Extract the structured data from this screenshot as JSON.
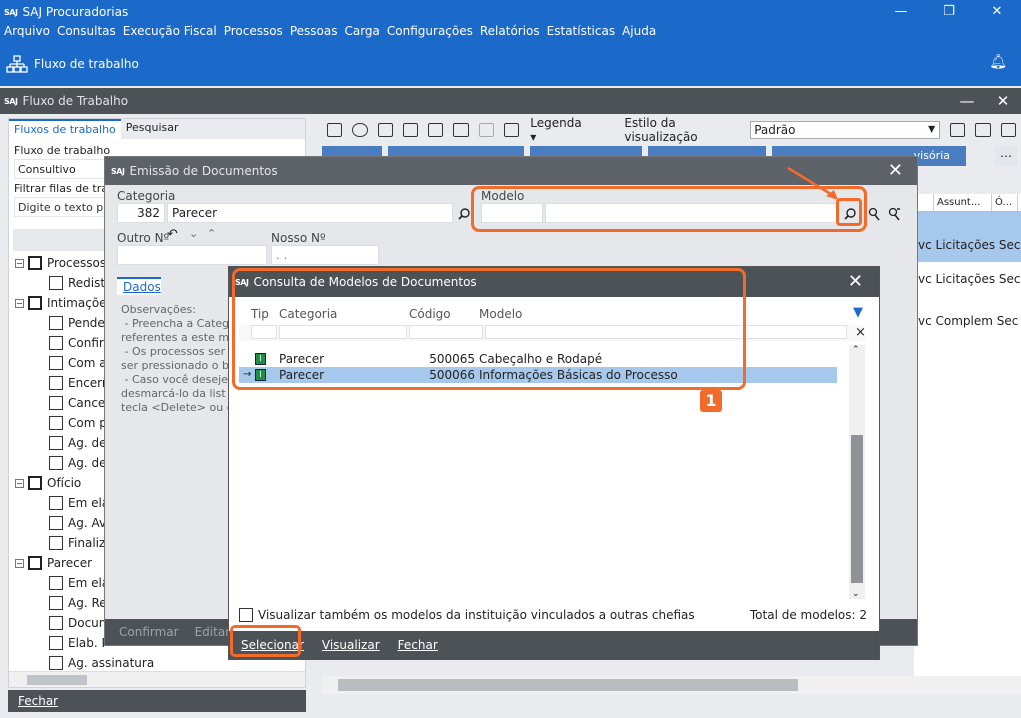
{
  "app": {
    "logo": "SAJ",
    "title": "SAJ Procuradorias",
    "menu": [
      "Arquivo",
      "Consultas",
      "Execução Fiscal",
      "Processos",
      "Pessoas",
      "Carga",
      "Configurações",
      "Relatórios",
      "Estatísticas",
      "Ajuda"
    ],
    "workflow_label": "Fluxo de trabalho"
  },
  "fluxo": {
    "title": "Fluxo de Trabalho",
    "tabs": [
      "Fluxos de trabalho",
      "Pesquisar"
    ],
    "fluxo_label": "Fluxo de trabalho",
    "fluxo_value": "Consultivo",
    "filtrar_label": "Filtrar filas de trab",
    "filtrar_placeholder": "Digite o texto pa",
    "tree": [
      {
        "level": 0,
        "label": "Processos",
        "box": "−"
      },
      {
        "level": 1,
        "label": "Redistr"
      },
      {
        "level": 0,
        "label": "Intimações",
        "box": "−"
      },
      {
        "level": 1,
        "label": "Penden"
      },
      {
        "level": 1,
        "label": "Confirm"
      },
      {
        "level": 1,
        "label": "Com as"
      },
      {
        "level": 1,
        "label": "Encerra"
      },
      {
        "level": 1,
        "label": "Cancela"
      },
      {
        "level": 1,
        "label": "Com pe"
      },
      {
        "level": 1,
        "label": "Ag. det"
      },
      {
        "level": 1,
        "label": "Ag. det"
      },
      {
        "level": 0,
        "label": "Ofício",
        "box": "−"
      },
      {
        "level": 1,
        "label": "Em elab"
      },
      {
        "level": 1,
        "label": "Ag. Ava"
      },
      {
        "level": 1,
        "label": "Finaliza"
      },
      {
        "level": 0,
        "label": "Parecer",
        "box": "−"
      },
      {
        "level": 1,
        "label": "Em elab"
      },
      {
        "level": 1,
        "label": "Ag. Rev"
      },
      {
        "level": 1,
        "label": "Docum"
      },
      {
        "level": 1,
        "label": "Elab. P"
      },
      {
        "level": 1,
        "label": "Ag. assinatura"
      }
    ],
    "footer_button": "Fechar",
    "toolbar": {
      "legenda": "Legenda",
      "estilo_label": "Estilo da visualização",
      "estilo_value": "Padrão"
    },
    "column_buttons": [
      "",
      "",
      "",
      "",
      "visória"
    ],
    "right_grid": {
      "headers": [
        "Assunt...",
        "Ó..."
      ],
      "rows": [
        "vc Licitações  Sec S",
        "vc Licitações  Sec S",
        "vc Complem  Sec S"
      ]
    }
  },
  "emissao": {
    "logo": "SAJ",
    "title": "Emissão de Documentos",
    "categoria_label": "Categoria",
    "categoria_code": "382",
    "categoria_name": "Parecer",
    "modelo_label": "Modelo",
    "outro_label": "Outro Nº",
    "nosso_label": "Nosso Nº",
    "nosso_value": ". .",
    "dados_tab": "Dados",
    "observacoes": "Observações:\n - Preencha a Categ\nreferentes a este m\n - Os processos ser\nser pressionado o b\n - Caso você deseje\ndesmarcá-lo da list\ntecla <Delete> ou c",
    "footer": [
      "Confirmar",
      "Editar"
    ]
  },
  "consulta": {
    "logo": "SAJ",
    "title": "Consulta de Modelos de Documentos",
    "columns": [
      "Tipo",
      "Categoria",
      "Código",
      "Modelo"
    ],
    "rows": [
      {
        "categoria": "Parecer",
        "codigo": "500065",
        "modelo": "Cabeçalho e Rodapé",
        "selected": false
      },
      {
        "categoria": "Parecer",
        "codigo": "500066",
        "modelo": "Informações Básicas do Processo",
        "selected": true
      }
    ],
    "checkbox_label": "Visualizar também os modelos da instituição vinculados a outras chefias",
    "total_label": "Total de modelos: 2",
    "footer": {
      "selecionar": "Selecionar",
      "visualizar": "Visualizar",
      "fechar": "Fechar"
    }
  },
  "annotation": {
    "number": "1",
    "color": "#f36b2b"
  }
}
